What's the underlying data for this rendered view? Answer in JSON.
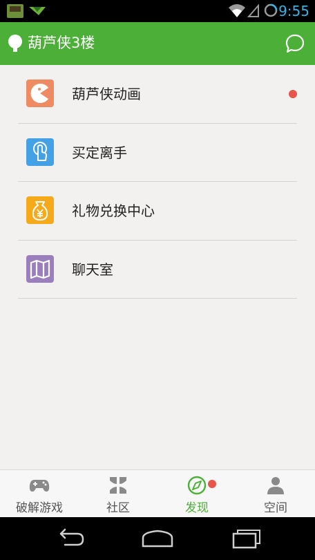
{
  "status_bar": {
    "time": "9:55"
  },
  "app_bar": {
    "title": "葫芦侠3楼"
  },
  "menu": {
    "items": [
      {
        "label": "葫芦侠动画",
        "icon": "pacman-icon",
        "color": "#ef8b62",
        "has_badge": true
      },
      {
        "label": "买定离手",
        "icon": "touch-hand-icon",
        "color": "#45a1e6"
      },
      {
        "label": "礼物兑换中心",
        "icon": "money-bag-icon",
        "color": "#f5aa1c"
      },
      {
        "label": "聊天室",
        "icon": "map-icon",
        "color": "#9b7fbc"
      }
    ]
  },
  "tab_bar": {
    "tabs": [
      {
        "label": "破解游戏",
        "icon": "gamepad-icon"
      },
      {
        "label": "社区",
        "icon": "community-icon"
      },
      {
        "label": "发现",
        "icon": "compass-icon",
        "active": true,
        "has_badge": true
      },
      {
        "label": "空间",
        "icon": "user-icon"
      }
    ]
  },
  "colors": {
    "accent": "#4caf37",
    "badge": "#e8564a",
    "time": "#35b5e5"
  }
}
